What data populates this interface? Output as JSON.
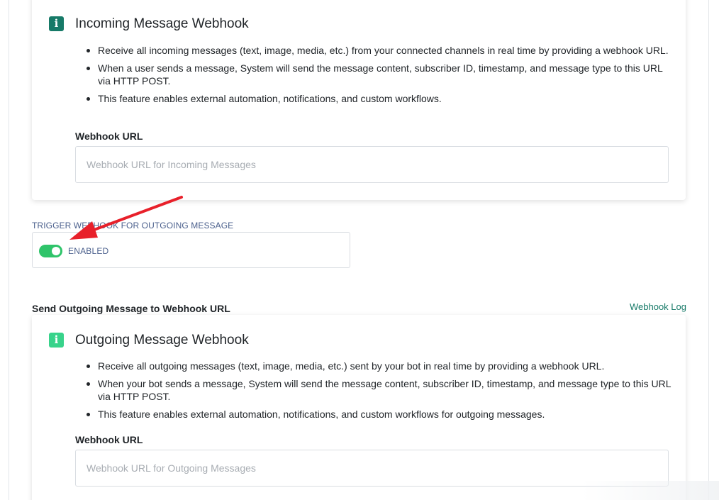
{
  "incoming": {
    "title": "Incoming Message Webhook",
    "bullets": [
      "Receive all incoming messages (text, image, media, etc.) from your connected channels in real time by providing a webhook URL.",
      "When a user sends a message, System will send the message content, subscriber ID, timestamp, and message type to this URL via HTTP POST.",
      "This feature enables external automation, notifications, and custom workflows."
    ],
    "field_label": "Webhook URL",
    "placeholder": "Webhook URL for Incoming Messages",
    "value": ""
  },
  "trigger": {
    "label": "TRIGGER WEBHOOK FOR OUTGOING MESSAGE",
    "state_text": "ENABLED",
    "enabled": true
  },
  "outgoing_section": {
    "title": "Send Outgoing Message to Webhook URL",
    "log_link": "Webhook Log"
  },
  "outgoing": {
    "title": "Outgoing Message Webhook",
    "bullets": [
      "Receive all outgoing messages (text, image, media, etc.) sent by your bot in real time by providing a webhook URL.",
      "When your bot sends a message, System will send the message content, subscriber ID, timestamp, and message type to this URL via HTTP POST.",
      "This feature enables external automation, notifications, and custom workflows for outgoing messages."
    ],
    "field_label": "Webhook URL",
    "placeholder": "Webhook URL for Outgoing Messages",
    "value": ""
  },
  "colors": {
    "brand_teal": "#177a68",
    "toggle_green": "#2fc46a",
    "arrow_red": "#e8202a"
  },
  "icons": {
    "info": "info-icon",
    "annotation": "red-arrow"
  }
}
